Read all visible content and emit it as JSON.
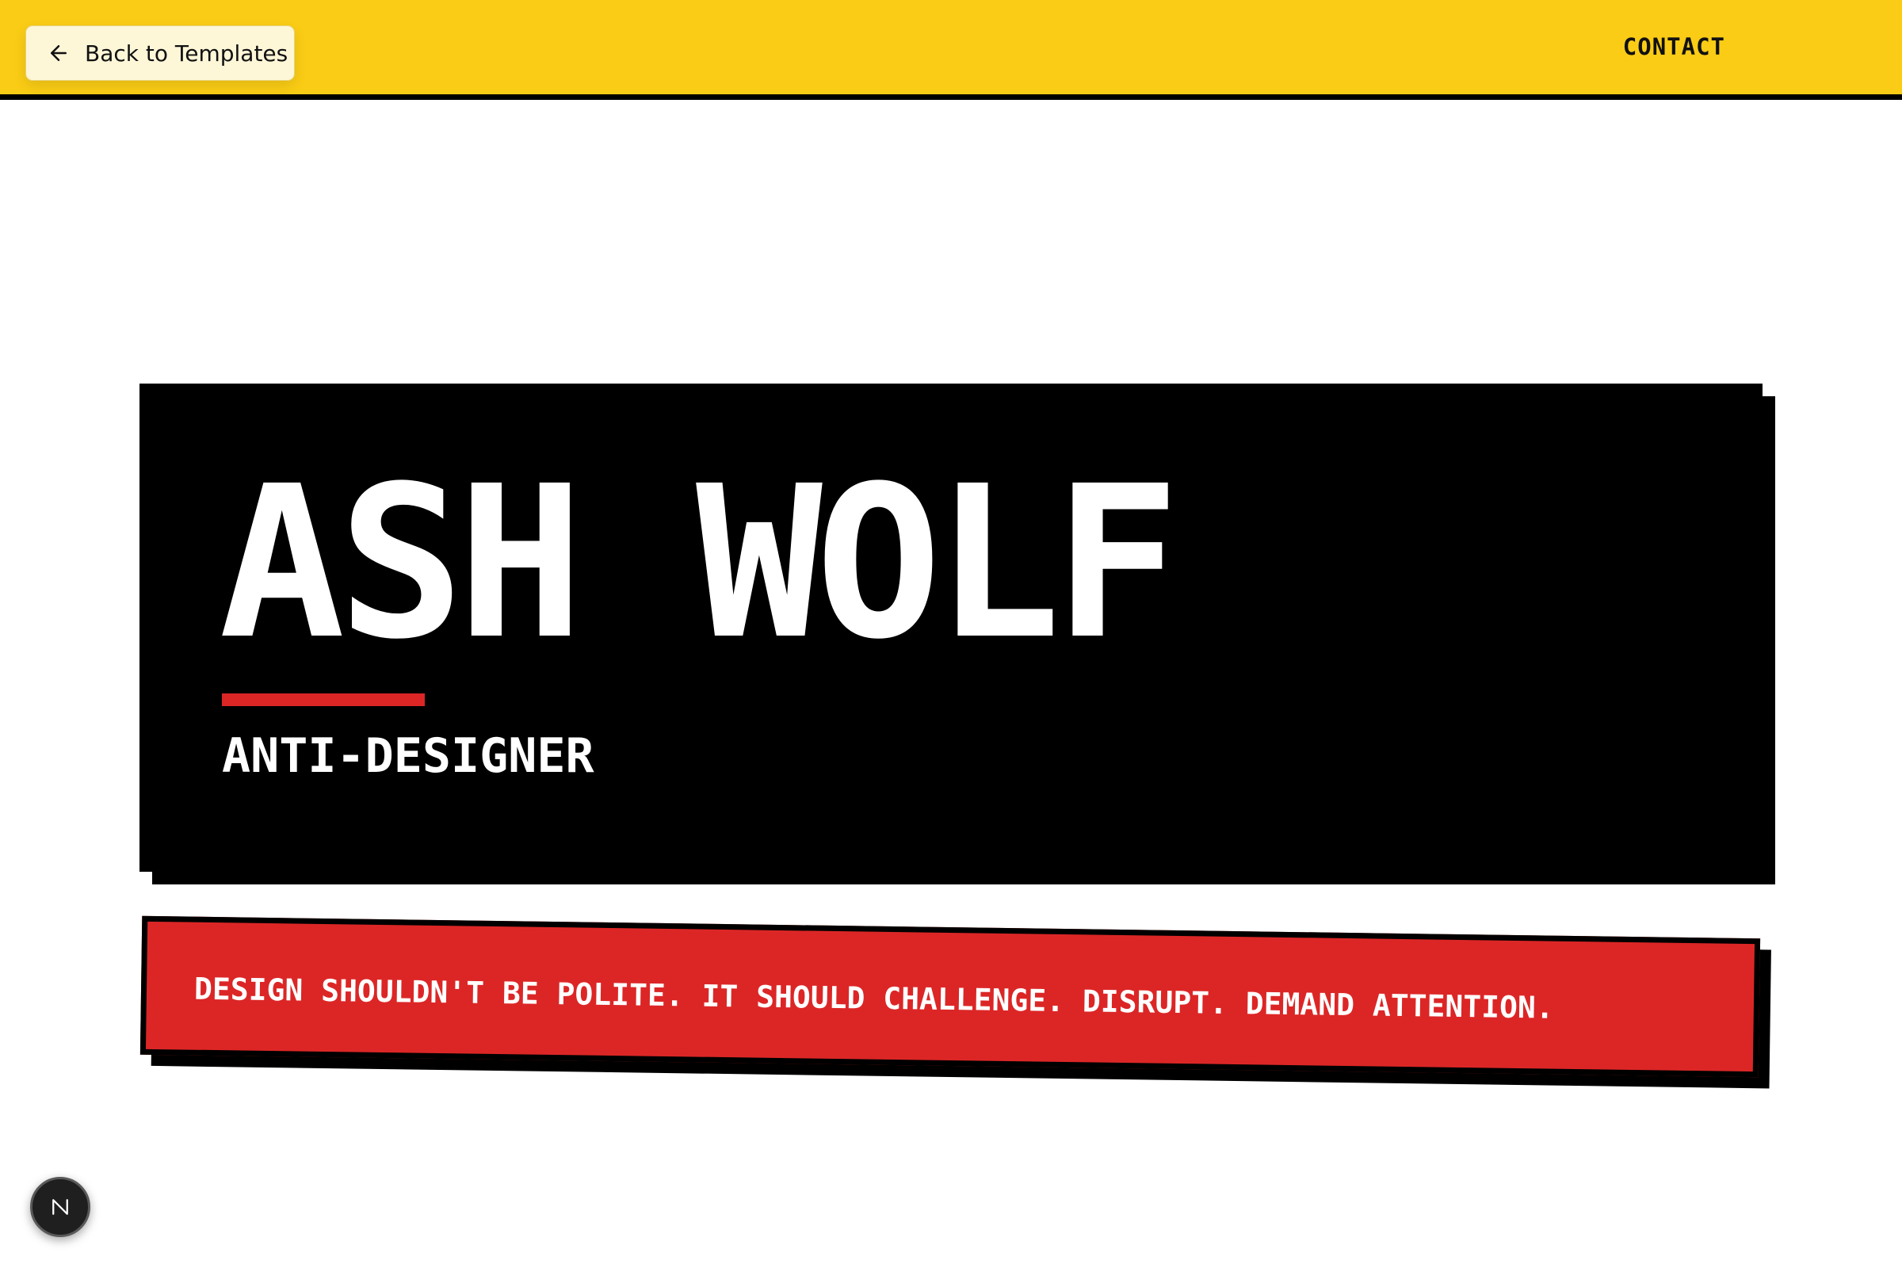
{
  "header": {
    "back_label": "Back to Templates",
    "back_icon": "arrow-left-icon",
    "nav_contact": "CONTACT"
  },
  "hero": {
    "name": "ASH WOLF",
    "role": "ANTI-DESIGNER"
  },
  "manifesto": {
    "text": "DESIGN SHOULDN'T BE POLITE. IT SHOULD CHALLENGE. DISRUPT. DEMAND ATTENTION."
  },
  "badge": {
    "icon": "n-logo-icon"
  },
  "colors": {
    "header_bg": "#facc15",
    "hero_bg": "#000000",
    "accent_red": "#dc2626",
    "text_light": "#ffffff"
  }
}
